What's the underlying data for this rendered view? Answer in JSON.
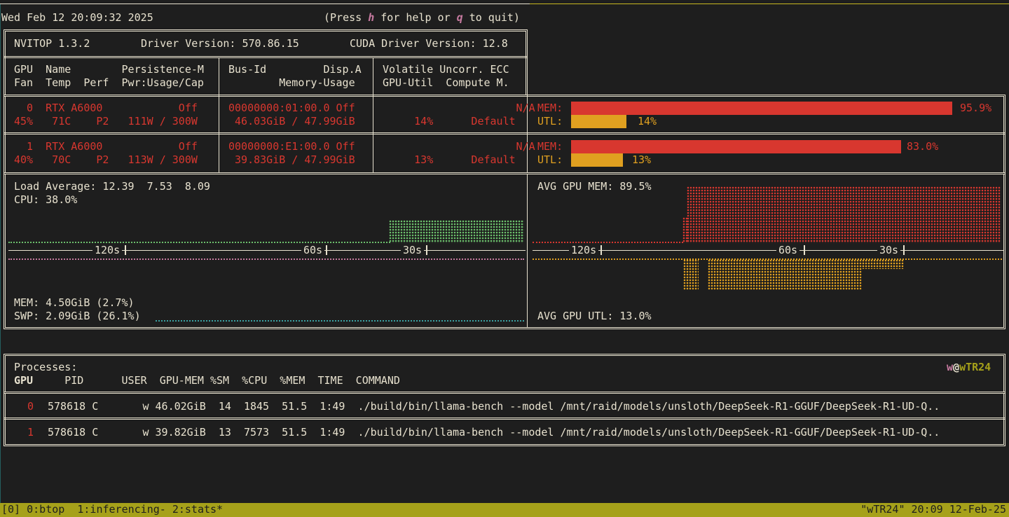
{
  "header": {
    "datetime": "Wed Feb 12 20:09:32 2025",
    "help_prefix": "(Press ",
    "help_key": "h",
    "help_mid": " for help or ",
    "quit_key": "q",
    "help_suffix": " to quit)"
  },
  "info": {
    "version": "NVITOP 1.3.2",
    "driver": "Driver Version: 570.86.15",
    "cuda": "CUDA Driver Version: 12.8"
  },
  "columns": {
    "row1_a": "GPU  Name        Persistence-M",
    "row2_a": "Fan  Temp  Perf  Pwr:Usage/Cap",
    "row1_b": "Bus-Id         Disp.A",
    "row2_b": "        Memory-Usage",
    "row1_c": "Volatile Uncorr. ECC",
    "row2_c": "GPU-Util  Compute M."
  },
  "gpus": [
    {
      "line1_a": "  0  RTX A6000            Off",
      "line2_a": "45%   71C    P2   111W / 300W",
      "line1_b": "00000000:01:00.0 Off",
      "line2_b": " 46.03GiB / 47.99GiB",
      "line1_c": "                 N/A",
      "line2_c": "     14%      Default",
      "mem_label": "MEM:",
      "mem_pct_text": "95.9%",
      "mem_fraction": 0.959,
      "utl_label": "UTL:",
      "utl_pct_text": "14%",
      "utl_fraction": 0.14
    },
    {
      "line1_a": "  1  RTX A6000            Off",
      "line2_a": "40%   70C    P2   113W / 300W",
      "line1_b": "00000000:E1:00.0 Off",
      "line2_b": " 39.83GiB / 47.99GiB",
      "line1_c": "                 N/A",
      "line2_c": "     13%      Default",
      "mem_label": "MEM:",
      "mem_pct_text": "83.0%",
      "mem_fraction": 0.83,
      "utl_label": "UTL:",
      "utl_pct_text": "13%",
      "utl_fraction": 0.13
    }
  ],
  "host": {
    "load_avg": "Load Average: 12.39  7.53  8.09",
    "cpu": "CPU: 38.0%",
    "mem": "MEM: 4.50GiB (2.7%)",
    "swp": "SWP: 2.09GiB (26.1%)",
    "time_labels": [
      "120s",
      "60s",
      "30s"
    ]
  },
  "gpu_summary": {
    "avg_mem": "AVG GPU MEM: 89.5%",
    "avg_utl": "AVG GPU UTL: 13.0%",
    "time_labels": [
      "120s",
      "60s",
      "30s"
    ]
  },
  "processes": {
    "title": "Processes:",
    "user_prefix": "w",
    "user_at": "@",
    "host_name": "wTR24",
    "headers": "GPU     PID      USER  GPU-MEM %SM  %CPU  %MEM  TIME  COMMAND",
    "rows": [
      {
        "gpu": "0",
        "rest": "578618 C       w 46.02GiB  14  1845  51.5  1:49  ./build/bin/llama-bench --model /mnt/raid/models/unsloth/DeepSeek-R1-GGUF/DeepSeek-R1-UD-Q.."
      },
      {
        "gpu": "1",
        "rest": "578618 C       w 39.82GiB  13  7573  51.5  1:49  ./build/bin/llama-bench --model /mnt/raid/models/unsloth/DeepSeek-R1-GGUF/DeepSeek-R1-UD-Q.."
      }
    ]
  },
  "statusbar": {
    "left": "[0] 0:btop  1:inferencing- 2:stats*",
    "right": "\"wTR24\" 20:09 12-Feb-25"
  },
  "colors": {
    "red": "#d8372f",
    "amber": "#e0a020",
    "green": "#6cc06c",
    "pink": "#c77aa0",
    "teal": "#3ba3a3",
    "status_bg": "#a6a11a"
  }
}
